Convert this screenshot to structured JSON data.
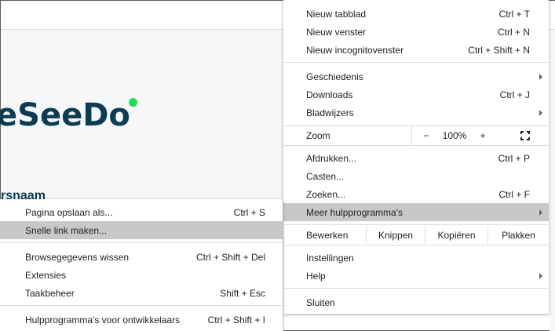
{
  "site": {
    "logo_text": "eSeeDo",
    "field_label": "rsnaam"
  },
  "main_menu": {
    "new_tab": {
      "label": "Nieuw tabblad",
      "shortcut": "Ctrl + T"
    },
    "new_window": {
      "label": "Nieuw venster",
      "shortcut": "Ctrl + N"
    },
    "new_incognito": {
      "label": "Nieuw incognitovenster",
      "shortcut": "Ctrl + Shift + N"
    },
    "history": {
      "label": "Geschiedenis"
    },
    "downloads": {
      "label": "Downloads",
      "shortcut": "Ctrl + J"
    },
    "bookmarks": {
      "label": "Bladwijzers"
    },
    "zoom": {
      "label": "Zoom",
      "minus": "−",
      "value": "100%",
      "plus": "+"
    },
    "print": {
      "label": "Afdrukken...",
      "shortcut": "Ctrl + P"
    },
    "cast": {
      "label": "Casten..."
    },
    "find": {
      "label": "Zoeken...",
      "shortcut": "Ctrl + F"
    },
    "more_tools": {
      "label": "Meer hulpprogramma's"
    },
    "edit": {
      "label": "Bewerken",
      "cut": "Knippen",
      "copy": "Kopiëren",
      "paste": "Plakken"
    },
    "settings": {
      "label": "Instellingen"
    },
    "help": {
      "label": "Help"
    },
    "exit": {
      "label": "Sluiten"
    }
  },
  "sub_menu": {
    "save_page": {
      "label": "Pagina opslaan als...",
      "shortcut": "Ctrl + S"
    },
    "quick_link": {
      "label": "Snelle link maken..."
    },
    "clear_data": {
      "label": "Browsegegevens wissen",
      "shortcut": "Ctrl + Shift + Del"
    },
    "extensions": {
      "label": "Extensies"
    },
    "task_manager": {
      "label": "Taakbeheer",
      "shortcut": "Shift + Esc"
    },
    "dev_tools": {
      "label": "Hulpprogramma's voor ontwikkelaars",
      "shortcut": "Ctrl + Shift + I"
    }
  },
  "colors": {
    "highlight": "#c8c8c8",
    "logo": "#0c3b52",
    "logo_dot": "#1ddb5c"
  }
}
